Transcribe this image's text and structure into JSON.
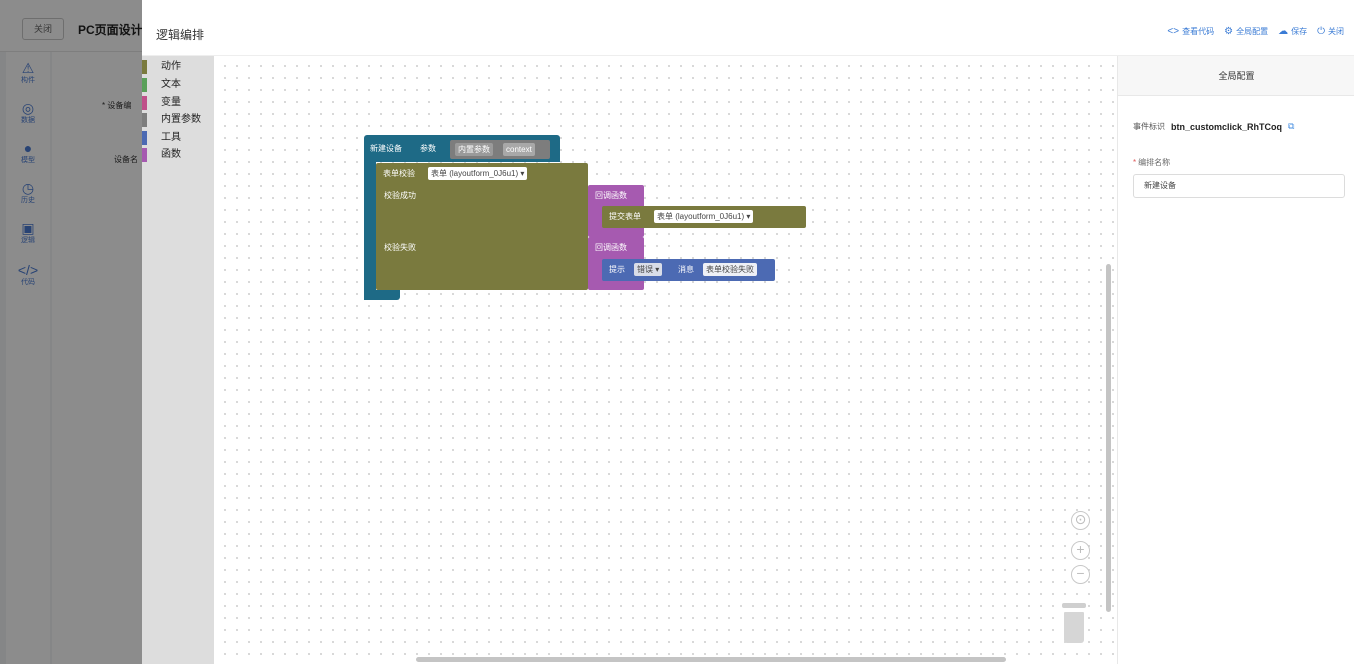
{
  "background_app": {
    "close_label": "关闭",
    "title": "PC页面设计",
    "nav": [
      {
        "icon": "component-icon",
        "glyph": "⚠",
        "label": "构件"
      },
      {
        "icon": "data-icon",
        "glyph": "◎",
        "label": "数据"
      },
      {
        "icon": "model-icon",
        "glyph": "●",
        "label": "模型"
      },
      {
        "icon": "history-icon",
        "glyph": "◷",
        "label": "历史"
      },
      {
        "icon": "logic-icon",
        "glyph": "▣",
        "label": "逻辑"
      },
      {
        "icon": "code-icon",
        "glyph": "</>",
        "label": "代码"
      }
    ],
    "panel_labels": [
      "* 设备编",
      "设备名"
    ]
  },
  "drawer": {
    "title": "逻辑编排",
    "actions": [
      {
        "icon": "view-code-icon",
        "glyph": "<>",
        "label": "查看代码"
      },
      {
        "icon": "global-config-icon",
        "glyph": "⚙",
        "label": "全局配置"
      },
      {
        "icon": "save-cloud-icon",
        "glyph": "☁",
        "label": "保存"
      },
      {
        "icon": "power-icon",
        "glyph": "⏻",
        "label": "关闭"
      }
    ]
  },
  "toolbox": {
    "categories": [
      {
        "label": "动作",
        "color": "#7a7a3e"
      },
      {
        "label": "文本",
        "color": "#5aa05a"
      },
      {
        "label": "变量",
        "color": "#c0508a"
      },
      {
        "label": "内置参数",
        "color": "#7d7d7d"
      },
      {
        "label": "工具",
        "color": "#4c6ab3"
      },
      {
        "label": "函数",
        "color": "#a65ab0"
      }
    ]
  },
  "blocks": {
    "main_label": "新建设备",
    "params_label": "参数",
    "builtin_param_label": "内置参数",
    "context_value": "context",
    "validate_label": "表单校验",
    "form_dropdown": "表单 (layoutform_0J6u1)",
    "success_label": "校验成功",
    "fail_label": "校验失败",
    "callback_label_1": "回调函数",
    "submit_label": "提交表单",
    "submit_form_dropdown": "表单 (layoutform_0J6u1)",
    "callback_label_2": "回调函数",
    "tip_label": "提示",
    "tip_type": "错误",
    "message_label": "消息",
    "message_value": "表单校验失败"
  },
  "zoom": {
    "center_glyph": "⊙",
    "plus_glyph": "+",
    "minus_glyph": "−"
  },
  "right_panel": {
    "header": "全局配置",
    "event_label": "事件标识",
    "event_value": "btn_customclick_RhTCoq",
    "copy_glyph": "⧉",
    "name_label": "编排名称",
    "name_value": "新建设备"
  }
}
